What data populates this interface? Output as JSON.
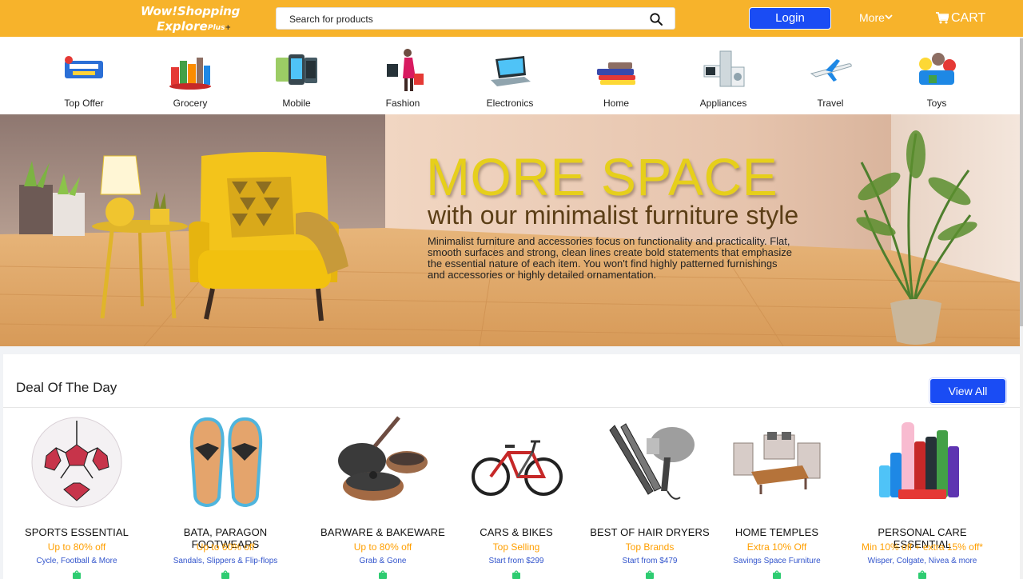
{
  "header": {
    "logo_line1": "Wow!Shopping",
    "logo_line2": "Explore",
    "logo_plus": "Plus",
    "search_placeholder": "Search for products",
    "login_label": "Login",
    "more_label": "More",
    "cart_label": "CART",
    "bg_color": "#f7b32b",
    "accent": "#1a4cf4"
  },
  "categories": [
    {
      "label": "Top Offer",
      "icon": "special-offer-tag-icon"
    },
    {
      "label": "Grocery",
      "icon": "grocery-icon"
    },
    {
      "label": "Mobile",
      "icon": "mobile-phone-icon"
    },
    {
      "label": "Fashion",
      "icon": "fashion-shopper-icon"
    },
    {
      "label": "Electronics",
      "icon": "laptop-icon"
    },
    {
      "label": "Home",
      "icon": "home-textiles-icon"
    },
    {
      "label": "Appliances",
      "icon": "appliances-icon"
    },
    {
      "label": "Travel",
      "icon": "airplane-icon"
    },
    {
      "label": "Toys",
      "icon": "toys-icon"
    }
  ],
  "banner": {
    "headline": "MORE SPACE",
    "subheadline": "with our minimalist furniture style",
    "body": "Minimalist furniture and accessories focus on functionality and practicality. Flat, smooth surfaces and strong, clean lines create bold statements that emphasize the essential nature of each item. You won't find highly patterned furnishings and accessories or highly detailed ornamentation."
  },
  "deals": {
    "title": "Deal Of The Day",
    "view_all_label": "View All",
    "items": [
      {
        "name": "SPORTS ESSENTIAL",
        "offer": "Up to 80% off",
        "sub": "Cycle, Football & More",
        "icon": "football-icon"
      },
      {
        "name": "BATA, PARAGON FOOTWEARS",
        "offer": "Up to 60% off",
        "sub": "Sandals, Slippers & Flip-flops",
        "icon": "flip-flops-icon"
      },
      {
        "name": "BARWARE & BAKEWARE",
        "offer": "Up to 80% off",
        "sub": "Grab & Gone",
        "icon": "cookware-icon"
      },
      {
        "name": "CARS & BIKES",
        "offer": "Top Selling",
        "sub": "Start from $299",
        "icon": "bicycle-icon"
      },
      {
        "name": "BEST OF HAIR DRYERS",
        "offer": "Top Brands",
        "sub": "Start from $479",
        "icon": "hair-dryer-icon"
      },
      {
        "name": "HOME TEMPLES",
        "offer": "Extra 10% Off",
        "sub": "Savings Space Furniture",
        "icon": "patio-furniture-icon"
      },
      {
        "name": "PERSONAL CARE ESSENTIAL",
        "offer": "Min 10% off + extra 15% off*",
        "sub": "Wisper, Colgate, Nivea & more",
        "icon": "personal-care-products-icon"
      }
    ]
  }
}
